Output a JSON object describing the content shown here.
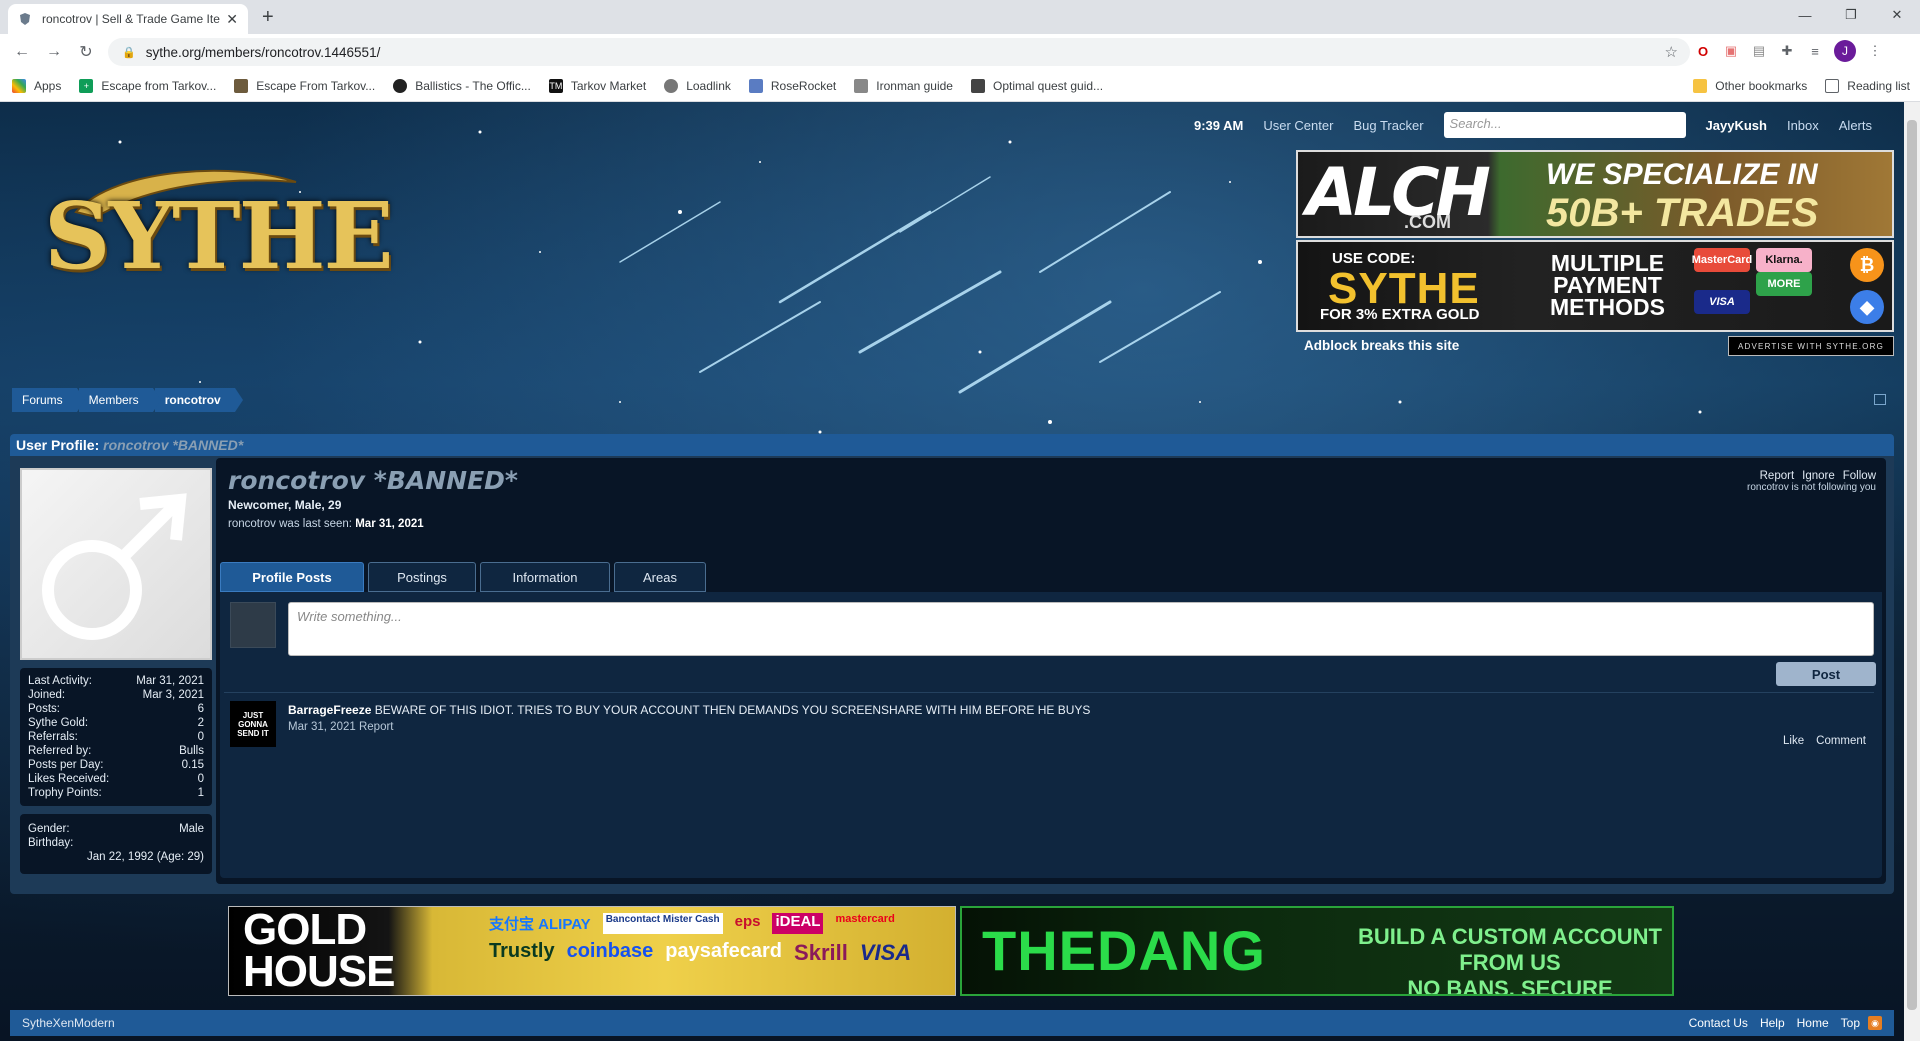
{
  "browser": {
    "tab_title": "roncotrov | Sell & Trade Game Items",
    "url": "sythe.org/members/roncotrov.1446551/",
    "bookmarks": [
      "Apps",
      "Escape from Tarkov...",
      "Escape From Tarkov...",
      "Ballistics - The Offic...",
      "Tarkov Market",
      "Loadlink",
      "RoseRocket",
      "Ironman guide",
      "Optimal quest guid..."
    ],
    "other_bookmarks": "Other bookmarks",
    "reading_list": "Reading list",
    "profile_initial": "J"
  },
  "header": {
    "time": "9:39 AM",
    "user_center": "User Center",
    "bug_tracker": "Bug Tracker",
    "search_placeholder": "Search...",
    "username": "JayyKush",
    "inbox": "Inbox",
    "alerts": "Alerts"
  },
  "logo": {
    "text": "SYTHE"
  },
  "ads": {
    "top_brand": "ALCH",
    "top_domain": ".COM",
    "top_slogan_1": "WE SPECIALIZE IN",
    "top_slogan_2": "50B+ TRADES",
    "use_code": "USE CODE:",
    "code": "SYTHE",
    "extra": "FOR 3% EXTRA GOLD",
    "payment_1": "MULTIPLE",
    "payment_2": "PAYMENT",
    "payment_3": "METHODS",
    "payment_logos": [
      "MasterCard",
      "Klarna.",
      "VISA",
      "MORE"
    ],
    "coins": [
      "₿",
      "◆"
    ],
    "adblock": "Adblock breaks this site",
    "advertise": "ADVERTISE WITH SYTHE.ORG",
    "bottom1_line1": "GOLD",
    "bottom1_line2": "HOUSE",
    "bottom1_methods": [
      "支付宝 ALIPAY",
      "Bancontact Mister Cash",
      "eps",
      "iDEAL",
      "mastercard",
      "Trustly",
      "coinbase",
      "paysafecard",
      "Skrill",
      "VISA"
    ],
    "bottom2_brand": "THEDANG",
    "bottom2_tag_1": "BUILD A CUSTOM ACCOUNT FROM US",
    "bottom2_tag_2": "NO BANS, SECURE DEDICATED SERVICE"
  },
  "breadcrumb": [
    "Forums",
    "Members",
    "roncotrov"
  ],
  "profile": {
    "panel_label": "User Profile:",
    "panel_name": "roncotrov *BANNED*",
    "name": "roncotrov *BANNED*",
    "subtitle": "Newcomer, Male, 29",
    "last_seen_label": "roncotrov was last seen:",
    "last_seen_value": "Mar 31, 2021",
    "actions": [
      "Report",
      "Ignore",
      "Follow"
    ],
    "follow_note": "roncotrov is not following you",
    "stats": [
      {
        "label": "Last Activity:",
        "value": "Mar 31, 2021"
      },
      {
        "label": "Joined:",
        "value": "Mar 3, 2021"
      },
      {
        "label": "Posts:",
        "value": "6"
      },
      {
        "label": "Sythe Gold:",
        "value": "2"
      },
      {
        "label": "Referrals:",
        "value": "0"
      },
      {
        "label": "Referred by:",
        "value": "Bulls"
      },
      {
        "label": "Posts per Day:",
        "value": "0.15"
      },
      {
        "label": "Likes Received:",
        "value": "0"
      },
      {
        "label": "Trophy Points:",
        "value": "1"
      }
    ],
    "gender_label": "Gender:",
    "gender_value": "Male",
    "birthday_label": "Birthday:",
    "birthday_value": "Jan 22, 1992 (Age: 29)"
  },
  "tabs": [
    "Profile Posts",
    "Postings",
    "Information",
    "Areas"
  ],
  "wall": {
    "placeholder": "Write something...",
    "post_button": "Post",
    "post_author": "BarrageFreeze",
    "post_text": "BEWARE OF THIS IDIOT. TRIES TO BUY YOUR ACCOUNT THEN DEMANDS YOU SCREENSHARE WITH HIM BEFORE HE BUYS",
    "post_date": "Mar 31, 2021",
    "post_report": "Report",
    "post_like": "Like",
    "post_comment": "Comment",
    "post_avatar_text": "JUST GONNA SEND IT"
  },
  "footer": {
    "style": "SytheXenModern",
    "links": [
      "Contact Us",
      "Help",
      "Home",
      "Top"
    ]
  }
}
